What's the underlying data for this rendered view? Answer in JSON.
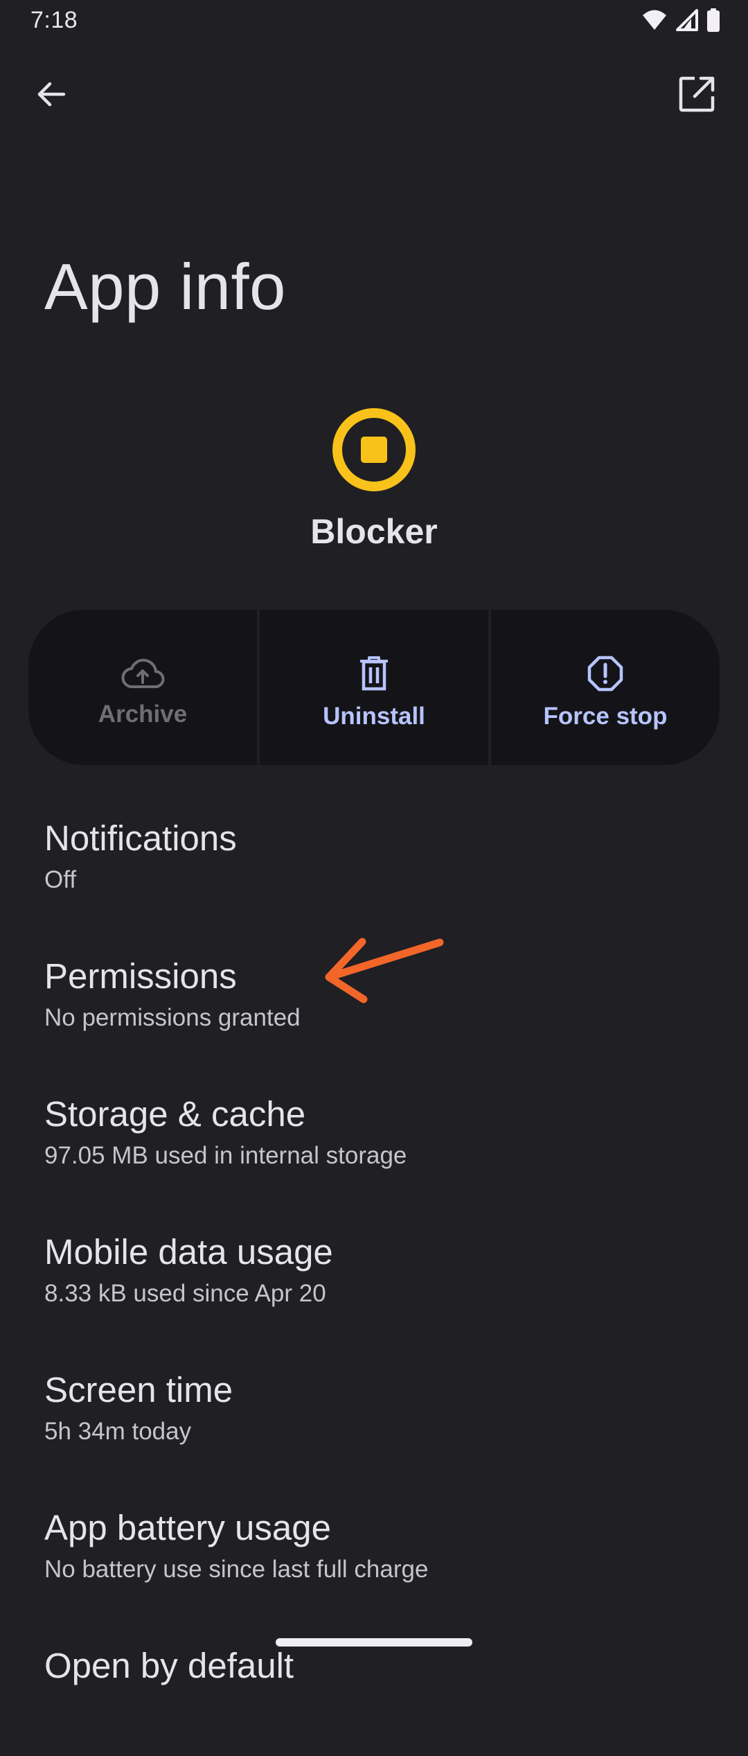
{
  "status_bar": {
    "time": "7:18",
    "icons": [
      "wifi-icon",
      "signal-icon",
      "battery-icon"
    ]
  },
  "toolbar": {
    "back_icon": "arrow-back-icon",
    "open_icon": "open-in-new-icon"
  },
  "page": {
    "title": "App info"
  },
  "app": {
    "name": "Blocker",
    "icon": "stop-circle-icon",
    "icon_color": "#f8c21b"
  },
  "actions": [
    {
      "label": "Archive",
      "icon": "cloud-upload-icon",
      "enabled": false
    },
    {
      "label": "Uninstall",
      "icon": "trash-icon",
      "enabled": true
    },
    {
      "label": "Force stop",
      "icon": "alert-octagon-icon",
      "enabled": true
    }
  ],
  "settings": [
    {
      "title": "Notifications",
      "subtitle": "Off"
    },
    {
      "title": "Permissions",
      "subtitle": "No permissions granted"
    },
    {
      "title": "Storage & cache",
      "subtitle": "97.05 MB used in internal storage"
    },
    {
      "title": "Mobile data usage",
      "subtitle": "8.33 kB used since Apr 20"
    },
    {
      "title": "Screen time",
      "subtitle": "5h 34m today"
    },
    {
      "title": "App battery usage",
      "subtitle": "No battery use since last full charge"
    },
    {
      "title": "Open by default",
      "subtitle": ""
    }
  ],
  "annotation": {
    "icon": "arrow-annotation-icon",
    "color": "#f2662a"
  },
  "colors": {
    "background": "#1f1f24",
    "accent": "#b7c4ff",
    "disabled": "#6f6e74"
  }
}
